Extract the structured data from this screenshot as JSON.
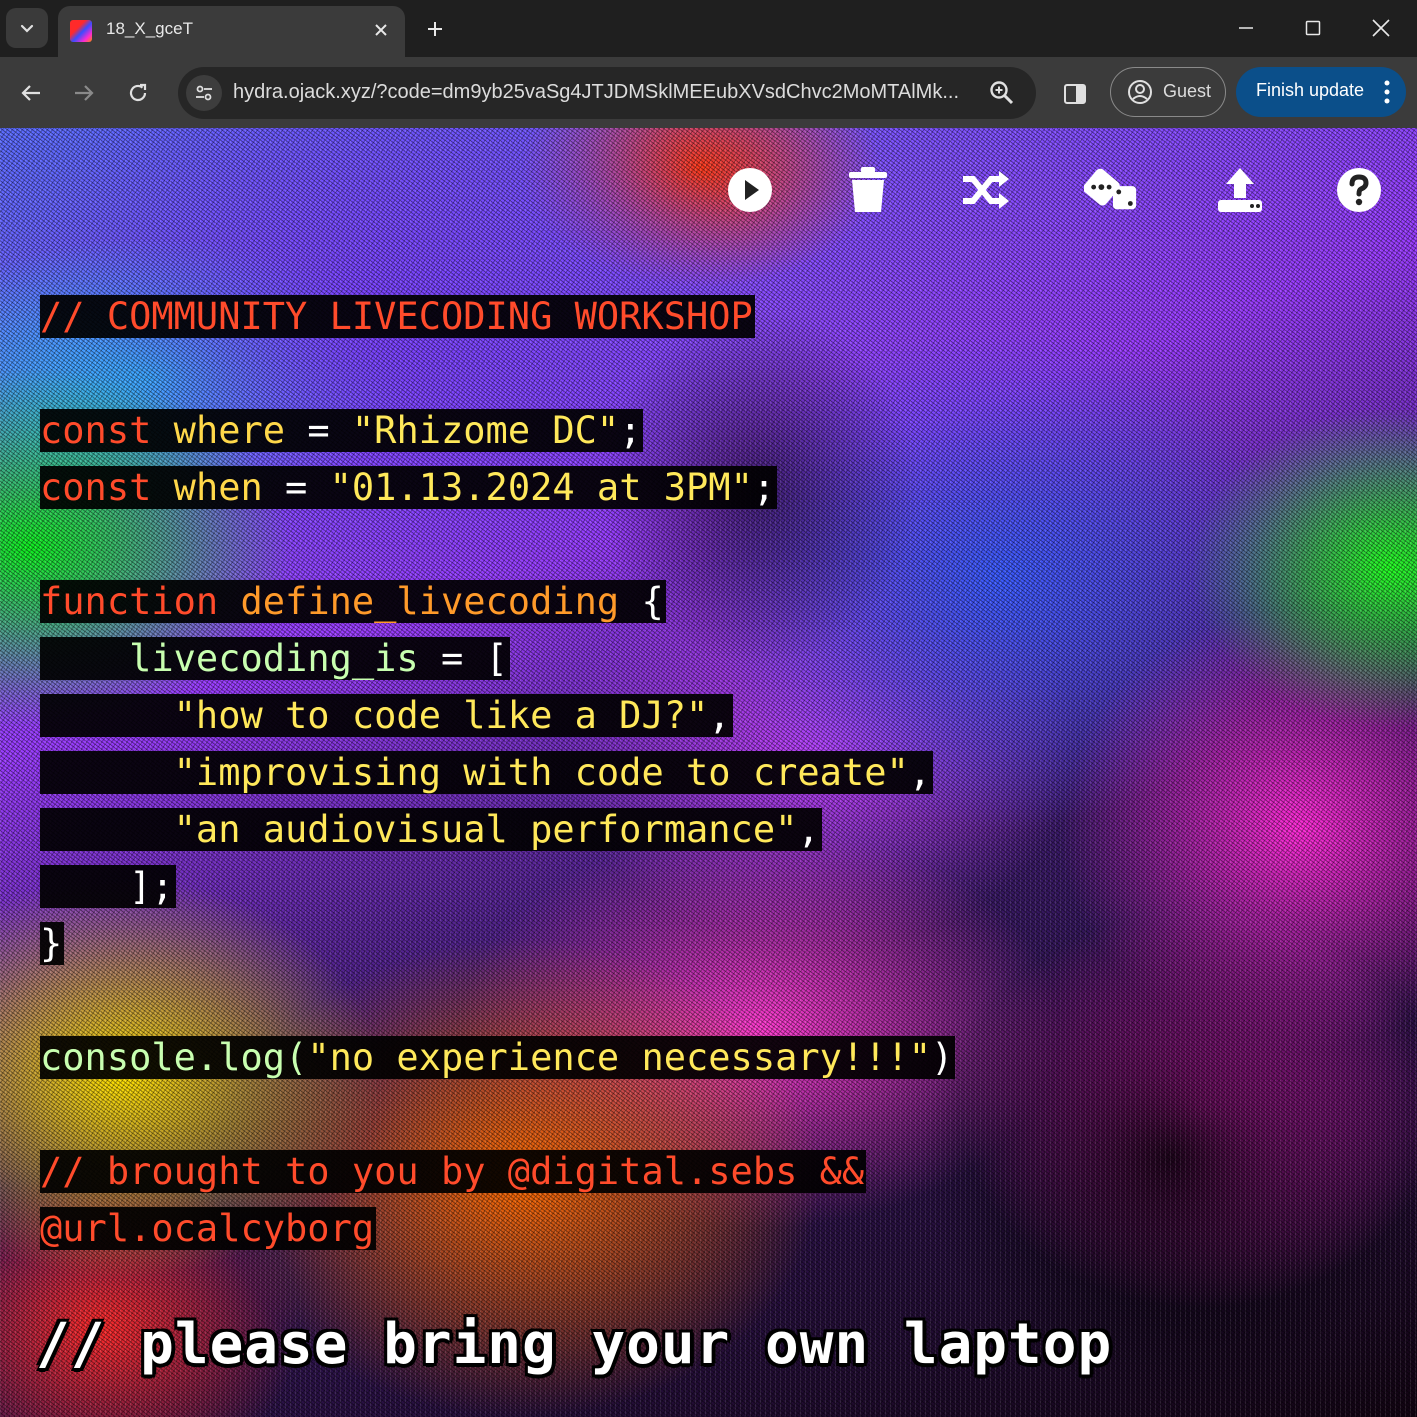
{
  "browser": {
    "tab": {
      "title": "18_X_gceT",
      "favicon": "hydra-favicon"
    },
    "url": "hydra.ojack.xyz/?code=dm9yb25vaSg4JTJDMSklMEEubXVsdChvc2MoMTAlMk...",
    "profile_label": "Guest",
    "update_label": "Finish update",
    "accent_color": "#0b4f8a"
  },
  "editor_toolbar": {
    "icons": [
      "play-icon",
      "trash-icon",
      "shuffle-icon",
      "dice-icon",
      "upload-icon",
      "help-icon"
    ]
  },
  "code": {
    "line1": "// COMMUNITY LIVECODING WORKSHOP",
    "const_kw": "const",
    "where_var": "where",
    "eq": " = ",
    "where_val": "\"Rhizome DC\"",
    "semicolon": ";",
    "when_var": "when",
    "when_val": "\"01.13.2024 at 3PM\"",
    "function_kw": "function",
    "function_name": "define_livecoding",
    "brace_open": "{",
    "livecoding_is": "livecoding_is",
    "eq_bracket": " = [",
    "item1": "\"how to code like a DJ?\"",
    "item2": "\"improvising with code to create\"",
    "item3": "\"an audiovisual performance\"",
    "comma": ",",
    "array_close": "];",
    "brace_close": "}",
    "console_log": "console.log(",
    "log_msg": "\"no experience necessary!!!\"",
    "paren_close": ")",
    "credit1": "// brought to you by @digital.sebs &&",
    "credit2": "@url.ocalcyborg"
  },
  "bottom_note": "// please bring your own laptop",
  "colors": {
    "keyword": "#ff4b2b",
    "string": "#ffe85a",
    "identifier": "#ffd84a"
  }
}
